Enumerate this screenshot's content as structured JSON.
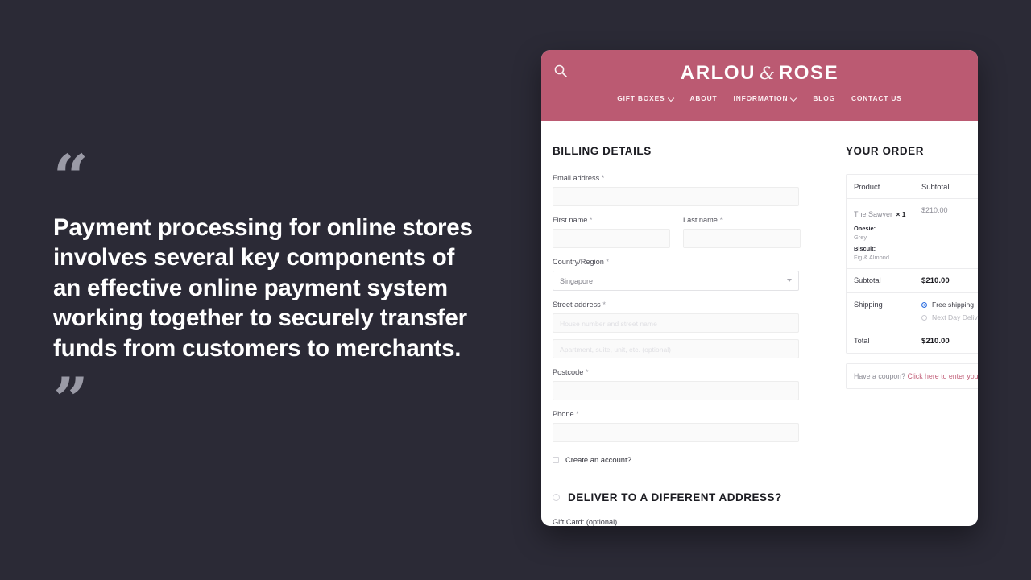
{
  "theme": {
    "background": "#2b2a36",
    "brand_pink": "#bb5a72",
    "link_pink": "#c2607a",
    "radio_blue": "#2e6fe0"
  },
  "quote": {
    "open_mark": "“",
    "close_mark": "”",
    "text": "Payment processing for online stores involves several key components of an effective online payment system working together to securely transfer funds from customers to merchants."
  },
  "site": {
    "brand_left": "ARLOU",
    "brand_amp": "&",
    "brand_right": "ROSE",
    "search_icon": "search-icon",
    "nav": [
      {
        "label": "GIFT BOXES",
        "has_chevron": true
      },
      {
        "label": "ABOUT",
        "has_chevron": false
      },
      {
        "label": "INFORMATION",
        "has_chevron": true
      },
      {
        "label": "BLOG",
        "has_chevron": false
      },
      {
        "label": "CONTACT US",
        "has_chevron": false
      }
    ]
  },
  "billing": {
    "title": "BILLING DETAILS",
    "required_mark": "*",
    "email_label": "Email address",
    "email_value": "",
    "first_name_label": "First name",
    "first_name_value": "",
    "last_name_label": "Last name",
    "last_name_value": "",
    "country_label": "Country/Region",
    "country_value": "Singapore",
    "street_label": "Street address",
    "street_placeholder": "House number and street name",
    "street2_placeholder": "Apartment, suite, unit, etc. (optional)",
    "postcode_label": "Postcode",
    "postcode_value": "",
    "phone_label": "Phone",
    "phone_value": "",
    "create_account_label": "Create an account?",
    "different_address_label": "DELIVER TO A DIFFERENT ADDRESS?",
    "gift_card_label": "Gift Card: (optional)"
  },
  "order": {
    "title": "YOUR ORDER",
    "col_product": "Product",
    "col_subtotal": "Subtotal",
    "item": {
      "name": "The Sawyer",
      "quantity": "× 1",
      "price": "$210.00",
      "meta": [
        {
          "key": "Onesie:",
          "value": "Grey"
        },
        {
          "key": "Biscuit:",
          "value": "Fig & Almond"
        }
      ]
    },
    "subtotal_label": "Subtotal",
    "subtotal_value": "$210.00",
    "shipping_label": "Shipping",
    "shipping_options": [
      {
        "label": "Free shipping",
        "selected": true
      },
      {
        "label": "Next Day Delivery",
        "selected": false
      }
    ],
    "total_label": "Total",
    "total_value": "$210.00",
    "coupon_prompt": "Have a coupon?",
    "coupon_link": "Click here to enter your code"
  }
}
